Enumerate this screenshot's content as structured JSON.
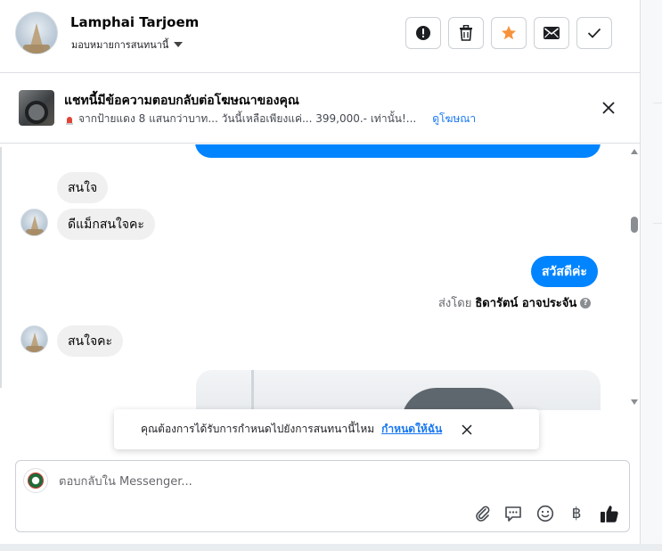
{
  "header": {
    "contact_name": "Lamphai Tarjoem",
    "assign_label": "มอบหมายการสนทนานี้",
    "actions": [
      {
        "icon": "alert-icon",
        "label": "Mark as spam"
      },
      {
        "icon": "trash-icon",
        "label": "Delete"
      },
      {
        "icon": "star-icon",
        "label": "Star",
        "color": "#f7923b"
      },
      {
        "icon": "envelope-icon",
        "label": "Mark unread"
      },
      {
        "icon": "check-icon",
        "label": "Done"
      }
    ]
  },
  "ad_banner": {
    "title": "แชทนี้มีข้อความตอบกลับต่อโฆษณาของคุณ",
    "description": "จากป้ายแดง 8 แสนกว่าบาท... วันนี้เหลือเพียงแค่... 399,000.- เท่านั้น!...",
    "link": "ดูโฆษณา"
  },
  "messages": {
    "incoming_1": "สนใจ",
    "incoming_2": "ดีแม็กสนใจคะ",
    "outgoing_1": "สวัสดีค่ะ",
    "sent_by_prefix": "ส่งโดย",
    "sent_by_name": "ธิดารัตน์ อาจประจัน",
    "incoming_3": "สนใจคะ"
  },
  "toast": {
    "text": "คุณต้องการได้รับการกำหนดไปยังการสนทนานี้ไหม",
    "action": "กำหนดให้ฉัน"
  },
  "composer": {
    "placeholder": "ตอบกลับใน Messenger...",
    "tools": [
      "paperclip-icon",
      "chat-bubble-icon",
      "smiley-icon",
      "baht-icon",
      "thumbs-up-icon"
    ],
    "baht_symbol": "฿"
  },
  "colors": {
    "accent": "#0084ff",
    "link": "#1877f2",
    "star": "#f7923b"
  }
}
